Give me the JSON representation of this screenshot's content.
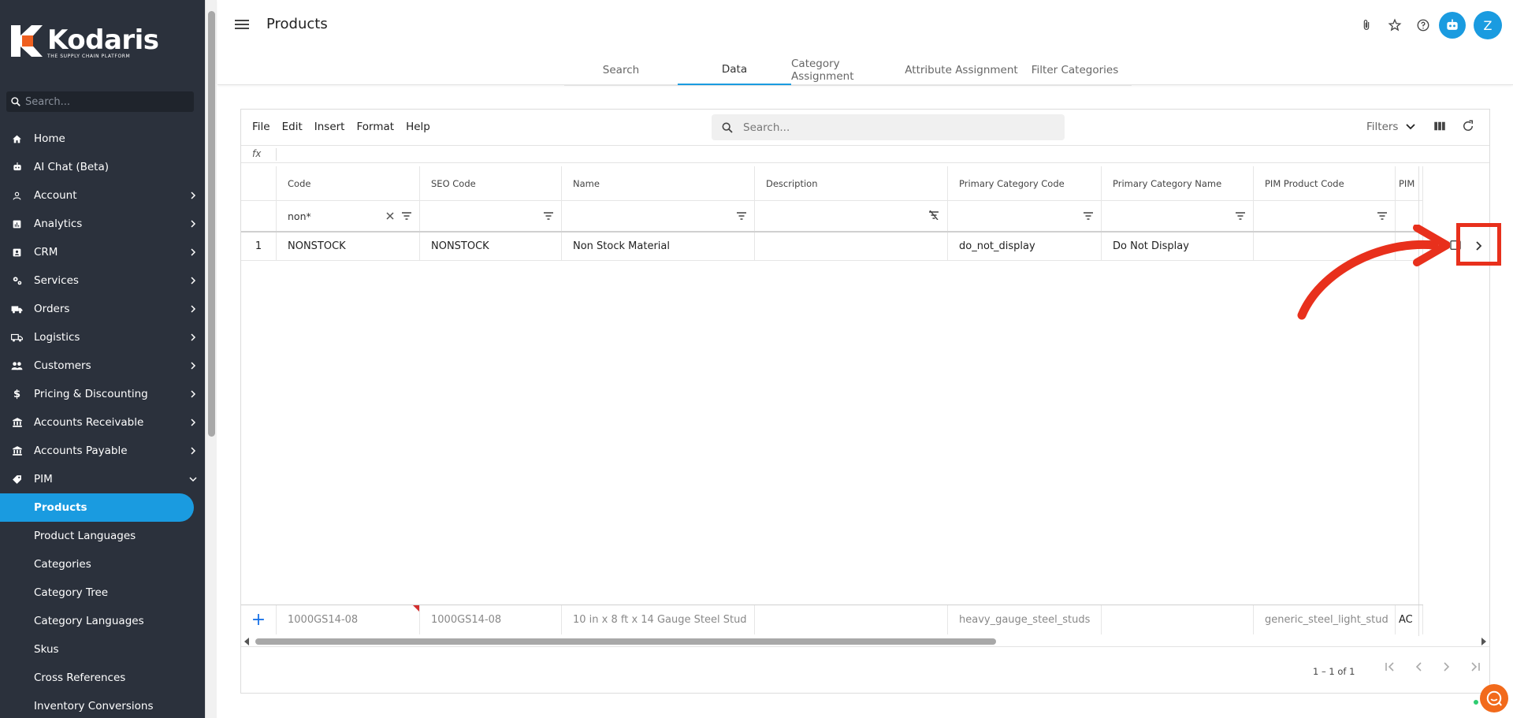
{
  "app": {
    "brand": "Kodaris",
    "tagline": "THE SUPPLY CHAIN PLATFORM",
    "accent": "#1a9be0"
  },
  "sidebar": {
    "search_placeholder": "Search...",
    "items": [
      {
        "label": "Home",
        "icon": "home-icon",
        "has_children": false
      },
      {
        "label": "AI Chat (Beta)",
        "icon": "robot-icon",
        "has_children": false
      },
      {
        "label": "Account",
        "icon": "person-icon",
        "has_children": true
      },
      {
        "label": "Analytics",
        "icon": "analytics-icon",
        "has_children": true
      },
      {
        "label": "CRM",
        "icon": "crm-icon",
        "has_children": true
      },
      {
        "label": "Services",
        "icon": "services-icon",
        "has_children": true
      },
      {
        "label": "Orders",
        "icon": "truck-icon",
        "has_children": true
      },
      {
        "label": "Logistics",
        "icon": "logistics-icon",
        "has_children": true
      },
      {
        "label": "Customers",
        "icon": "people-icon",
        "has_children": true
      },
      {
        "label": "Pricing & Discounting",
        "icon": "dollar-icon",
        "has_children": true
      },
      {
        "label": "Accounts Receivable",
        "icon": "bank-icon",
        "has_children": true
      },
      {
        "label": "Accounts Payable",
        "icon": "bank-icon",
        "has_children": true
      },
      {
        "label": "PIM",
        "icon": "tag-icon",
        "has_children": true,
        "expanded": true
      }
    ],
    "pim_children": [
      "Products",
      "Product Languages",
      "Categories",
      "Category Tree",
      "Category Languages",
      "Skus",
      "Cross References",
      "Inventory Conversions"
    ],
    "active": "Products"
  },
  "header": {
    "title": "Products",
    "avatar_initial": "Z"
  },
  "tabs": [
    "Search",
    "Data",
    "Category Assignment",
    "Attribute Assignment",
    "Filter Categories"
  ],
  "active_tab": "Data",
  "toolbar": {
    "menus": [
      "File",
      "Edit",
      "Insert",
      "Format",
      "Help"
    ],
    "search_placeholder": "Search...",
    "filters_label": "Filters",
    "fx": "fx"
  },
  "grid": {
    "columns": [
      "Code",
      "SEO Code",
      "Name",
      "Description",
      "Primary Category Code",
      "Primary Category Name",
      "PIM Product Code",
      "PIM"
    ],
    "filters": {
      "code": "non*"
    },
    "rows": [
      {
        "row_number": "1",
        "cells": [
          "NONSTOCK",
          "NONSTOCK",
          "Non Stock Material",
          "",
          "do_not_display",
          "Do Not Display",
          "",
          ""
        ]
      }
    ],
    "new_row": {
      "cells": [
        "1000GS14-08",
        "1000GS14-08",
        "10 in x 8 ft x 14 Gauge Steel Stud",
        "",
        "heavy_gauge_steel_studs",
        "",
        "generic_steel_light_stud",
        "AC"
      ]
    },
    "pagination": {
      "range": "1 – 1 of 1"
    }
  }
}
